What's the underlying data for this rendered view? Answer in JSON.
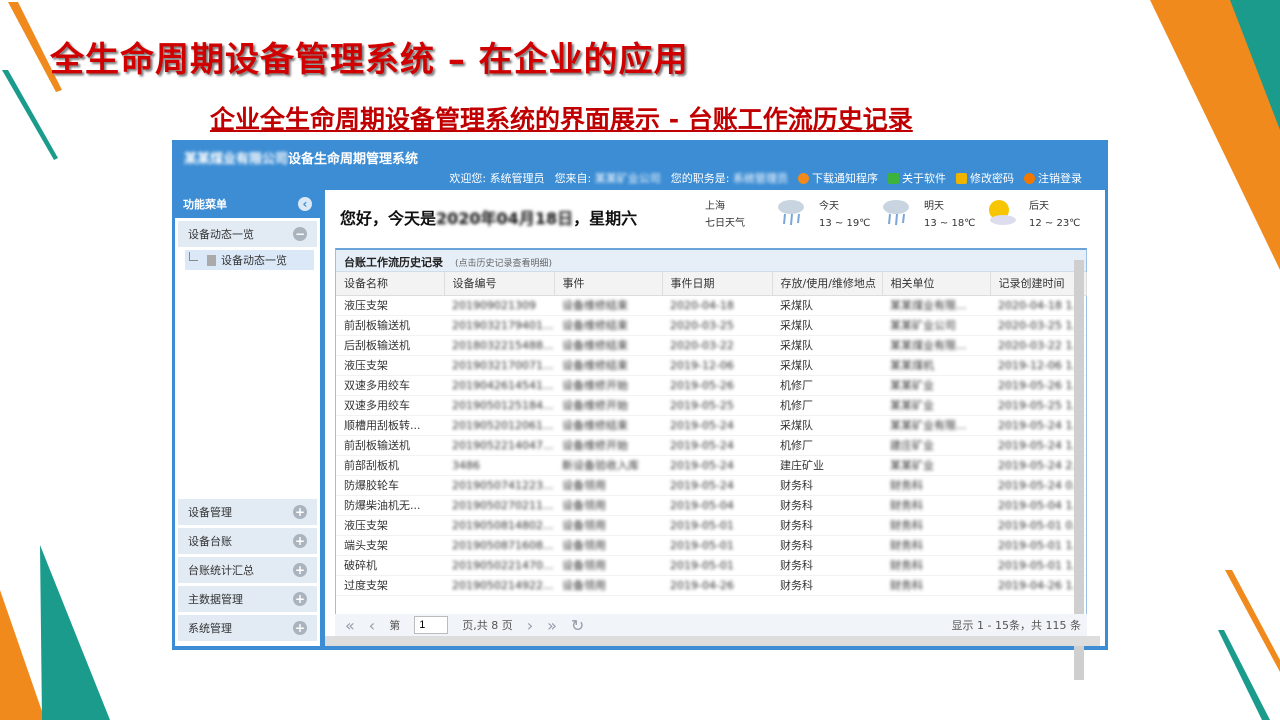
{
  "slide": {
    "title": "全生命周期设备管理系统 – 在企业的应用",
    "subtitle": "企业全生命周期设备管理系统的界面展示 - 台账工作流历史记录"
  },
  "header": {
    "company": "某某煤业有限公司",
    "system": "设备生命周期管理系统",
    "welcome_label": "欢迎您:",
    "user": "系统管理员",
    "from_label": "您来自:",
    "from_company": "某某矿业公司",
    "role_label": "您的职务是:",
    "role": "系统管理员",
    "links": [
      {
        "label": "下载通知程序",
        "color": "#f08a1c"
      },
      {
        "label": "关于软件",
        "color": "#3cb43c"
      },
      {
        "label": "修改密码",
        "color": "#f0b400"
      },
      {
        "label": "注销登录",
        "color": "#f07800"
      }
    ]
  },
  "sidebar": {
    "title": "功能菜单",
    "open_group": "设备动态一览",
    "open_item": "设备动态一览",
    "groups": [
      "设备管理",
      "设备台账",
      "台账统计汇总",
      "主数据管理",
      "系统管理"
    ]
  },
  "greeting": {
    "prefix": "您好，今天是",
    "date": "2020年04月18日",
    "suffix": "，星期六"
  },
  "weather": {
    "city": "上海",
    "label": "七日天气",
    "days": [
      {
        "name": "今天",
        "temp": "13 ~ 19℃",
        "icon": "rain-icon"
      },
      {
        "name": "明天",
        "temp": "13 ~ 18℃",
        "icon": "rain-icon"
      },
      {
        "name": "后天",
        "temp": "12 ~ 23℃",
        "icon": "sun-cloud-icon"
      }
    ]
  },
  "panel": {
    "title": "台账工作流历史记录",
    "hint": "(点击历史记录查看明细)"
  },
  "table": {
    "columns": [
      "设备名称",
      "设备编号",
      "事件",
      "事件日期",
      "存放/使用/维修地点",
      "相关单位",
      "记录创建时间"
    ],
    "rows": [
      [
        "液压支架",
        "201909021309",
        "设备维修结束",
        "2020-04-18",
        "采煤队",
        "某某煤业有限...",
        "2020-04-18 14..."
      ],
      [
        "前刮板输送机",
        "2019032179401...",
        "设备维修结束",
        "2020-03-25",
        "采煤队",
        "某某矿业公司",
        "2020-03-25 16..."
      ],
      [
        "后刮板输送机",
        "2018032215488...",
        "设备维修结束",
        "2020-03-22",
        "采煤队",
        "某某煤业有限...",
        "2020-03-22 10..."
      ],
      [
        "液压支架",
        "2019032170071...",
        "设备维修结束",
        "2019-12-06",
        "采煤队",
        "某某煤机",
        "2019-12-06 11..."
      ],
      [
        "双速多用绞车",
        "2019042614541...",
        "设备维修开始",
        "2019-05-26",
        "机修厂",
        "某某矿业",
        "2019-05-26 14..."
      ],
      [
        "双速多用绞车",
        "2019050125184...",
        "设备维修开始",
        "2019-05-25",
        "机修厂",
        "某某矿业",
        "2019-05-25 18..."
      ],
      [
        "顺槽用刮板转...",
        "2019052012061...",
        "设备维修结束",
        "2019-05-24",
        "采煤队",
        "某某矿业有限...",
        "2019-05-24 10..."
      ],
      [
        "前刮板输送机",
        "2019052214047...",
        "设备维修开始",
        "2019-05-24",
        "机修厂",
        "建庄矿业",
        "2019-05-24 13..."
      ],
      [
        "前部刮板机",
        "3486",
        "新设备验收入库",
        "2019-05-24",
        "建庄矿业",
        "某某矿业",
        "2019-05-24 21..."
      ],
      [
        "防爆胶轮车",
        "2019050741223...",
        "设备领用",
        "2019-05-24",
        "财务科",
        "财务科",
        "2019-05-24 09..."
      ],
      [
        "防爆柴油机无...",
        "2019050270211...",
        "设备领用",
        "2019-05-04",
        "财务科",
        "财务科",
        "2019-05-04 16..."
      ],
      [
        "液压支架",
        "2019050814802...",
        "设备领用",
        "2019-05-01",
        "财务科",
        "财务科",
        "2019-05-01 09..."
      ],
      [
        "端头支架",
        "2019050871608...",
        "设备领用",
        "2019-05-01",
        "财务科",
        "财务科",
        "2019-05-01 15..."
      ],
      [
        "破碎机",
        "2019050221470...",
        "设备领用",
        "2019-05-01",
        "财务科",
        "财务科",
        "2019-05-01 16..."
      ],
      [
        "过度支架",
        "2019050214922...",
        "设备领用",
        "2019-04-26",
        "财务科",
        "财务科",
        "2019-04-26 14..."
      ]
    ]
  },
  "pager": {
    "page_label": "第",
    "page": "1",
    "total": "页,共 8 页",
    "display": "显示 1 - 15条，共 115 条"
  }
}
